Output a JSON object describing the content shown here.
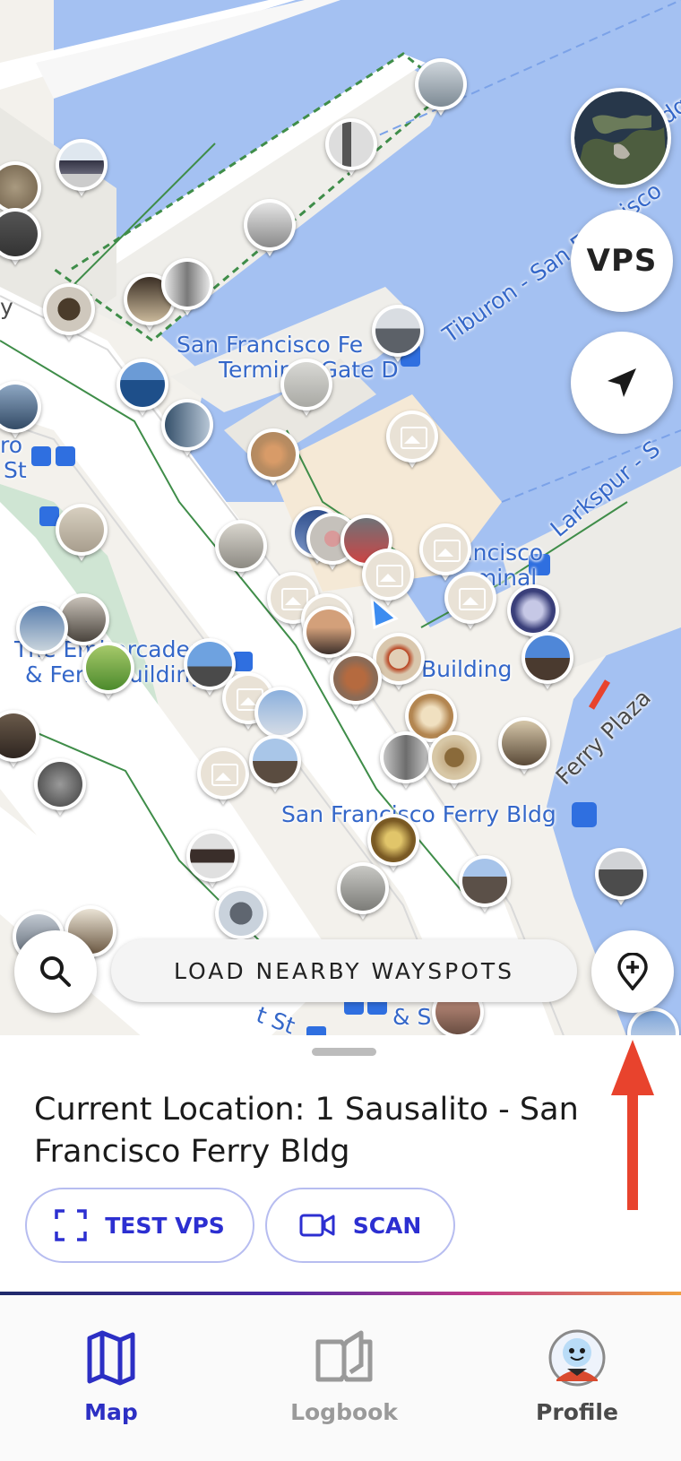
{
  "map": {
    "labels": {
      "terminal_line1": "San Francisco Fe",
      "terminal_line2": "Terminal Gate D",
      "tiburon_route": "Tiburon - San Francisco",
      "larkspur_route": "Larkspur - S",
      "ferry_terminal_1": "rancisco",
      "ferry_terminal_2": "rminal",
      "embarcadero_1": "The Embarcadero",
      "embarcadero_2": "& Ferry Building",
      "building": "Building",
      "ferry_plaza": "Ferry Plaza",
      "ferry_bldg": "San Francisco Ferry Bldg",
      "st_left": "St",
      "st_left2": "ro",
      "street_bottom": "& S  St",
      "st_bottom_left": "t St",
      "edge_letter": "y",
      "edge_letter2": "dg"
    }
  },
  "controls": {
    "vps_label": "VPS",
    "load_wayspots_label": "LOAD NEARBY WAYSPOTS"
  },
  "sheet": {
    "current_location": "Current Location: 1 Sausalito - San Francisco Ferry Bldg",
    "test_vps_label": "TEST VPS",
    "scan_label": "SCAN"
  },
  "nav": {
    "map_label": "Map",
    "logbook_label": "Logbook",
    "profile_label": "Profile"
  },
  "colors": {
    "water": "#a4c1f2",
    "pier": "#efeeea",
    "accent": "#2c2fd1",
    "annotation": "#e8432d"
  }
}
